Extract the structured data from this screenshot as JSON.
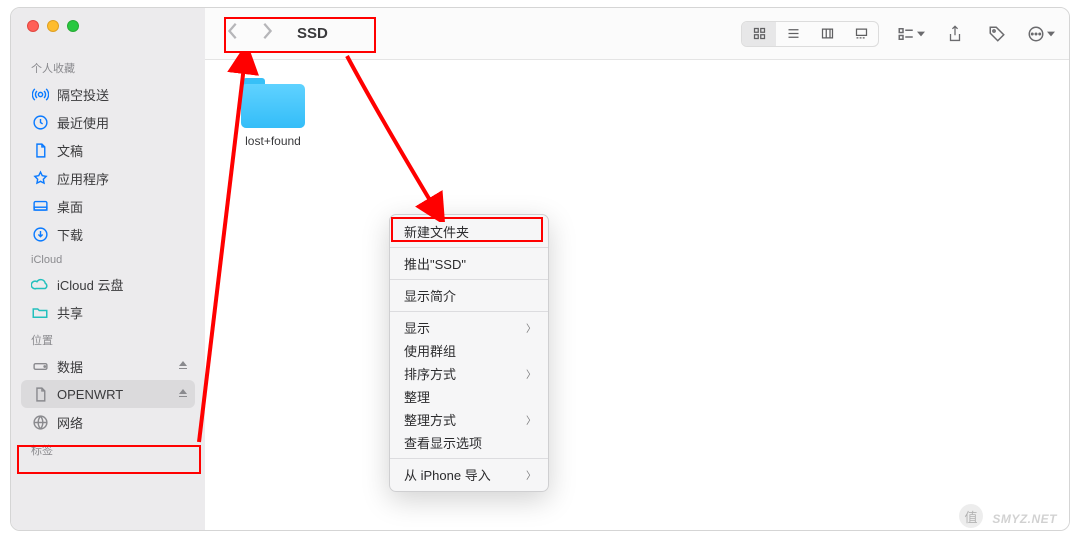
{
  "window_title": "SSD",
  "sidebar": {
    "sections": [
      {
        "heading": "个人收藏",
        "items": [
          {
            "label": "隔空投送",
            "icon": "airdrop"
          },
          {
            "label": "最近使用",
            "icon": "clock"
          },
          {
            "label": "文稿",
            "icon": "document"
          },
          {
            "label": "应用程序",
            "icon": "apps"
          },
          {
            "label": "桌面",
            "icon": "desktop"
          },
          {
            "label": "下载",
            "icon": "downloads"
          }
        ]
      },
      {
        "heading": "iCloud",
        "items": [
          {
            "label": "iCloud 云盘",
            "icon": "cloud"
          },
          {
            "label": "共享",
            "icon": "shared"
          }
        ]
      },
      {
        "heading": "位置",
        "items": [
          {
            "label": "数据",
            "icon": "disk",
            "eject": true
          },
          {
            "label": "OPENWRT",
            "icon": "document",
            "eject": true,
            "selected": true
          },
          {
            "label": "网络",
            "icon": "network"
          }
        ]
      },
      {
        "heading": "标签",
        "items": []
      }
    ]
  },
  "files": [
    {
      "name": "lost+found",
      "type": "folder"
    }
  ],
  "context_menu": [
    {
      "label": "新建文件夹",
      "highlighted": true
    },
    {
      "sep": true
    },
    {
      "label": "推出\"SSD\""
    },
    {
      "sep": true
    },
    {
      "label": "显示简介"
    },
    {
      "sep": true
    },
    {
      "label": "显示",
      "sub": true
    },
    {
      "label": "使用群组"
    },
    {
      "label": "排序方式",
      "sub": true
    },
    {
      "label": "整理"
    },
    {
      "label": "整理方式",
      "sub": true
    },
    {
      "label": "查看显示选项"
    },
    {
      "sep": true
    },
    {
      "label": "从 iPhone 导入",
      "sub": true
    }
  ],
  "watermark": {
    "badge": "值",
    "text": "SMYZ.NET"
  },
  "colors": {
    "accent": "#0a7aff",
    "highlight": "#ff0000",
    "folder": "#34bdf8"
  }
}
